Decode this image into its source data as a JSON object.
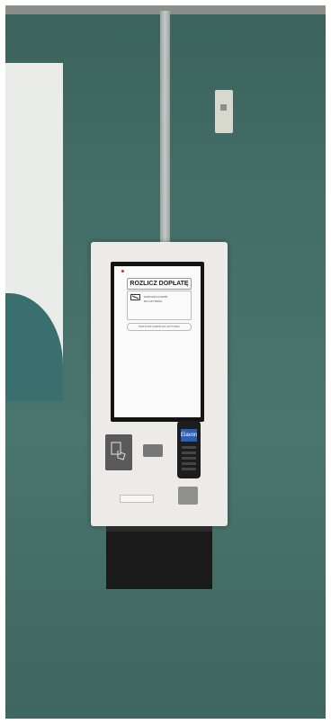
{
  "scene": {
    "wall_color": "#436d66"
  },
  "kiosk": {
    "screen": {
      "title": "ROZLICZ DOPŁATĘ",
      "info_lines": [
        "ZASTOSUJ KARTĘ",
        "DO CZYTNIKA"
      ],
      "button_label": "PRZYŁÓŻ KARTĘ DO CZYTNIKA"
    },
    "terminal_brand": "Elavon"
  }
}
